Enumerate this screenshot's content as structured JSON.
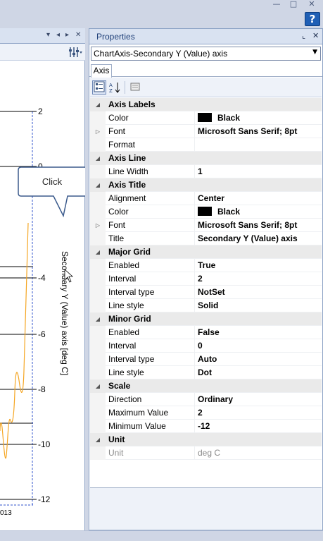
{
  "window": {
    "minimize_icon": "minimize-icon",
    "maximize_icon": "maximize-icon",
    "close_icon": "close-icon",
    "help_icon": "help-icon",
    "help_label": "?"
  },
  "chart": {
    "axis_title": "Secondary Y (Value) axis [deg C]",
    "ticks": [
      "2",
      "0",
      "-4",
      "-6",
      "-8",
      "-10",
      "-12"
    ],
    "x_label_fragment": "013",
    "line_color": "#f5a623"
  },
  "callout": {
    "text": "Click"
  },
  "properties": {
    "title": "Properties",
    "selector_value": "ChartAxis-Secondary Y (Value) axis",
    "tab": "Axis",
    "rows": [
      {
        "kind": "cat",
        "name": "Axis Labels"
      },
      {
        "kind": "prop",
        "name": "Color",
        "value": "Black",
        "swatch": "#000000"
      },
      {
        "kind": "prop",
        "name": "Font",
        "value": "Microsoft Sans Serif; 8pt",
        "expand": true
      },
      {
        "kind": "prop",
        "name": "Format",
        "value": ""
      },
      {
        "kind": "cat",
        "name": "Axis Line"
      },
      {
        "kind": "prop",
        "name": "Line Width",
        "value": "1"
      },
      {
        "kind": "cat",
        "name": "Axis Title"
      },
      {
        "kind": "prop",
        "name": "Alignment",
        "value": "Center"
      },
      {
        "kind": "prop",
        "name": "Color",
        "value": "Black",
        "swatch": "#000000"
      },
      {
        "kind": "prop",
        "name": "Font",
        "value": "Microsoft Sans Serif; 8pt",
        "expand": true
      },
      {
        "kind": "prop",
        "name": "Title",
        "value": "Secondary Y (Value) axis"
      },
      {
        "kind": "cat",
        "name": "Major Grid"
      },
      {
        "kind": "prop",
        "name": "Enabled",
        "value": "True"
      },
      {
        "kind": "prop",
        "name": "Interval",
        "value": "2"
      },
      {
        "kind": "prop",
        "name": "Interval type",
        "value": "NotSet"
      },
      {
        "kind": "prop",
        "name": "Line style",
        "value": "Solid"
      },
      {
        "kind": "cat",
        "name": "Minor Grid"
      },
      {
        "kind": "prop",
        "name": "Enabled",
        "value": "False"
      },
      {
        "kind": "prop",
        "name": "Interval",
        "value": "0"
      },
      {
        "kind": "prop",
        "name": "Interval type",
        "value": "Auto"
      },
      {
        "kind": "prop",
        "name": "Line style",
        "value": "Dot"
      },
      {
        "kind": "cat",
        "name": "Scale"
      },
      {
        "kind": "prop",
        "name": "Direction",
        "value": "Ordinary"
      },
      {
        "kind": "prop",
        "name": "Maximum Value",
        "value": "2"
      },
      {
        "kind": "prop",
        "name": "Minimum Value",
        "value": "-12"
      },
      {
        "kind": "cat",
        "name": "Unit"
      },
      {
        "kind": "prop",
        "name": "Unit",
        "value": "deg C",
        "dim": true
      }
    ]
  }
}
